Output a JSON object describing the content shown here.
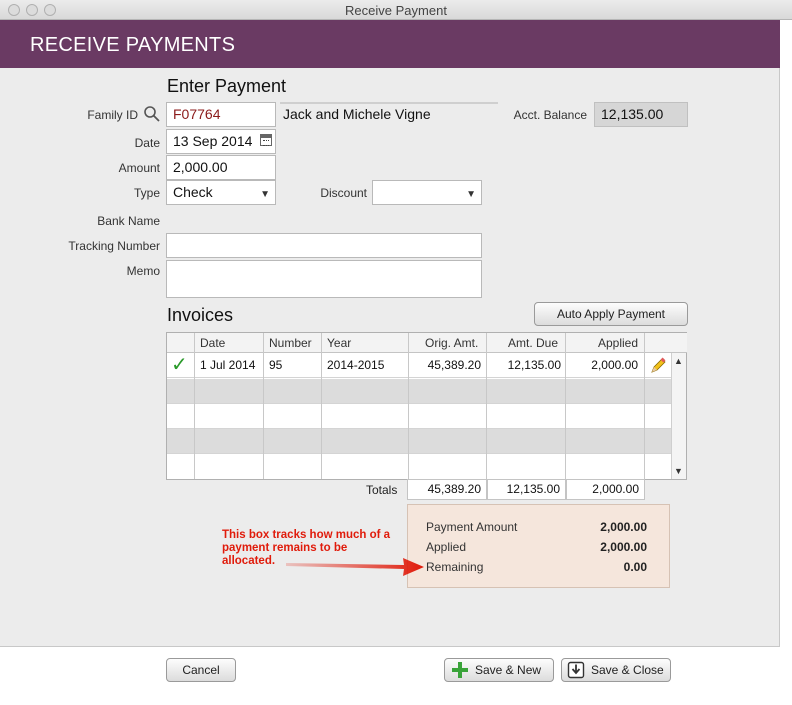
{
  "window": {
    "title": "Receive Payment"
  },
  "header": {
    "title": "RECEIVE PAYMENTS"
  },
  "payment": {
    "section_title": "Enter Payment",
    "family_id_label": "Family ID",
    "family_id": "F07764",
    "family_name": "Jack and Michele Vigne",
    "acct_balance_label": "Acct. Balance",
    "acct_balance": "12,135.00",
    "date_label": "Date",
    "date": "13 Sep 2014",
    "amount_label": "Amount",
    "amount": "2,000.00",
    "type_label": "Type",
    "type": "Check",
    "discount_label": "Discount",
    "discount": "",
    "bank_name_label": "Bank Name",
    "tracking_label": "Tracking Number",
    "tracking": "",
    "memo_label": "Memo",
    "memo": ""
  },
  "invoices": {
    "section_title": "Invoices",
    "auto_apply_label": "Auto Apply Payment",
    "columns": [
      "Date",
      "Number",
      "Year",
      "Orig. Amt.",
      "Amt. Due",
      "Applied"
    ],
    "rows": [
      {
        "checked": "✓",
        "date": "1 Jul 2014",
        "number": "95",
        "year": "2014-2015",
        "orig": "45,389.20",
        "due": "12,135.00",
        "applied": "2,000.00"
      }
    ],
    "totals_label": "Totals",
    "totals": {
      "orig": "45,389.20",
      "due": "12,135.00",
      "applied": "2,000.00"
    }
  },
  "summary": {
    "payment_amount_label": "Payment Amount",
    "payment_amount": "2,000.00",
    "applied_label": "Applied",
    "applied": "2,000.00",
    "remaining_label": "Remaining",
    "remaining": "0.00"
  },
  "annotation": {
    "text": "This box tracks how much of a payment remains to be allocated."
  },
  "footer": {
    "cancel_label": "Cancel",
    "save_new_label": "Save & New",
    "save_close_label": "Save & Close"
  },
  "colors": {
    "header_bg": "#6a3a63",
    "annotation": "#e01b0b",
    "summary_bg": "#f5e6dc"
  },
  "icons": {
    "search": "magnifier-icon",
    "check": "checkmark-icon",
    "edit": "pencil-icon",
    "save_new": "plus-icon",
    "save_close": "save-arrow-icon"
  }
}
